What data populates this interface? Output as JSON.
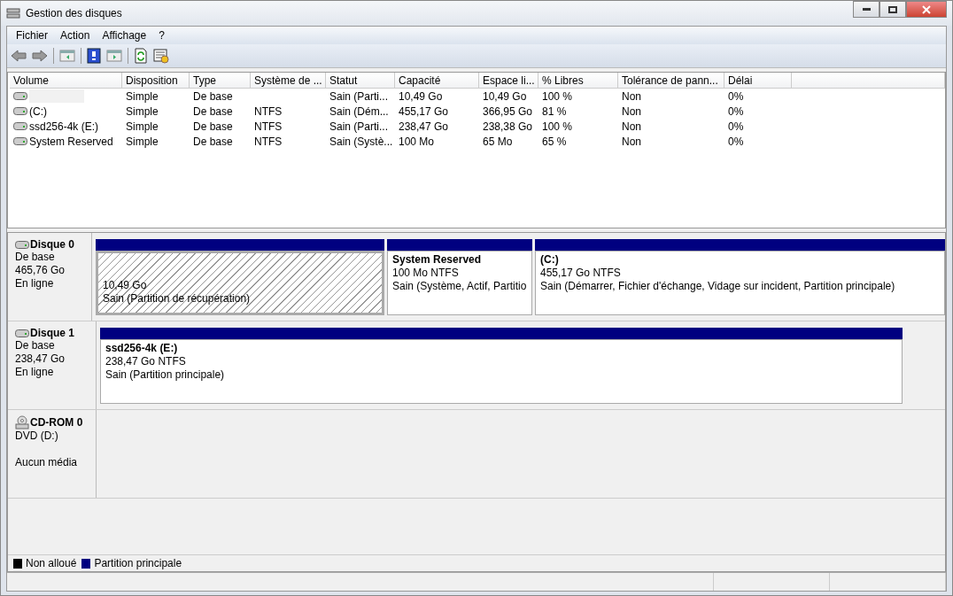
{
  "window": {
    "title": "Gestion des disques"
  },
  "menu": [
    "Fichier",
    "Action",
    "Affichage",
    "?"
  ],
  "table": {
    "columns": [
      "Volume",
      "Disposition",
      "Type",
      "Système de ...",
      "Statut",
      "Capacité",
      "Espace li...",
      "% Libres",
      "Tolérance de pann...",
      "Délai"
    ],
    "rows": [
      {
        "cells": [
          "",
          "Simple",
          "De base",
          "",
          "Sain (Parti...",
          "10,49 Go",
          "10,49 Go",
          "100 %",
          "Non",
          "0%"
        ]
      },
      {
        "cells": [
          " (C:)",
          "Simple",
          "De base",
          "NTFS",
          "Sain (Dém...",
          "455,17 Go",
          "366,95 Go",
          "81 %",
          "Non",
          "0%"
        ]
      },
      {
        "cells": [
          "ssd256-4k (E:)",
          "Simple",
          "De base",
          "NTFS",
          "Sain (Parti...",
          "238,47 Go",
          "238,38 Go",
          "100 %",
          "Non",
          "0%"
        ]
      },
      {
        "cells": [
          "System Reserved",
          "Simple",
          "De base",
          "NTFS",
          "Sain (Systè...",
          "100 Mo",
          "65 Mo",
          "65 %",
          "Non",
          "0%"
        ]
      }
    ]
  },
  "disks": [
    {
      "kind": "disk",
      "name": "Disque 0",
      "lines": [
        "De base",
        "465,76 Go",
        "En ligne"
      ],
      "partitions": [
        {
          "selected": true,
          "lines": [
            "10,49 Go",
            "Sain (Partition de récupération)"
          ]
        },
        {
          "selected": false,
          "title": "System Reserved",
          "lines": [
            "100 Mo NTFS",
            "Sain (Système, Actif, Partitio"
          ]
        },
        {
          "selected": false,
          "title": " (C:)",
          "lines": [
            "455,17 Go NTFS",
            "Sain (Démarrer, Fichier d'échange, Vidage sur incident, Partition principale)"
          ]
        }
      ]
    },
    {
      "kind": "disk",
      "name": "Disque 1",
      "lines": [
        "De base",
        "238,47 Go",
        "En ligne"
      ],
      "partitions": [
        {
          "selected": false,
          "title": "ssd256-4k  (E:)",
          "lines": [
            "238,47 Go NTFS",
            "Sain (Partition principale)"
          ]
        }
      ]
    },
    {
      "kind": "cdrom",
      "name": "CD-ROM 0",
      "lines": [
        "DVD (D:)",
        "Aucun média"
      ]
    }
  ],
  "legend": [
    {
      "label": "Non alloué",
      "color": "#000000"
    },
    {
      "label": "Partition principale",
      "color": "#000080"
    }
  ]
}
